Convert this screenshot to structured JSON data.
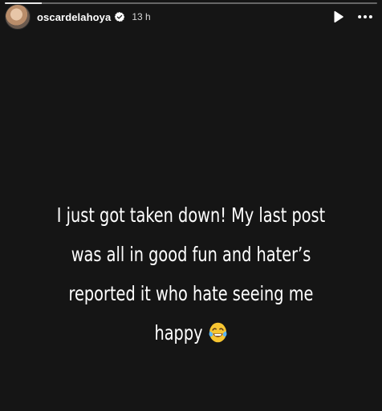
{
  "story": {
    "progress": 0.1,
    "user": {
      "username": "oscardelahoya",
      "verified": true,
      "time_ago": "13 h"
    },
    "controls": {
      "play_icon": "play-icon",
      "more_icon": "more-options-icon"
    },
    "caption": {
      "lines": [
        "I just got taken down! My last post",
        "was all in good fun and hater’s",
        "reported it who hate seeing me",
        "happy"
      ],
      "emoji": "face-with-tears-of-joy"
    }
  },
  "colors": {
    "background": "#151515",
    "text": "#ffffff",
    "verified_badge": "#3897f0"
  }
}
